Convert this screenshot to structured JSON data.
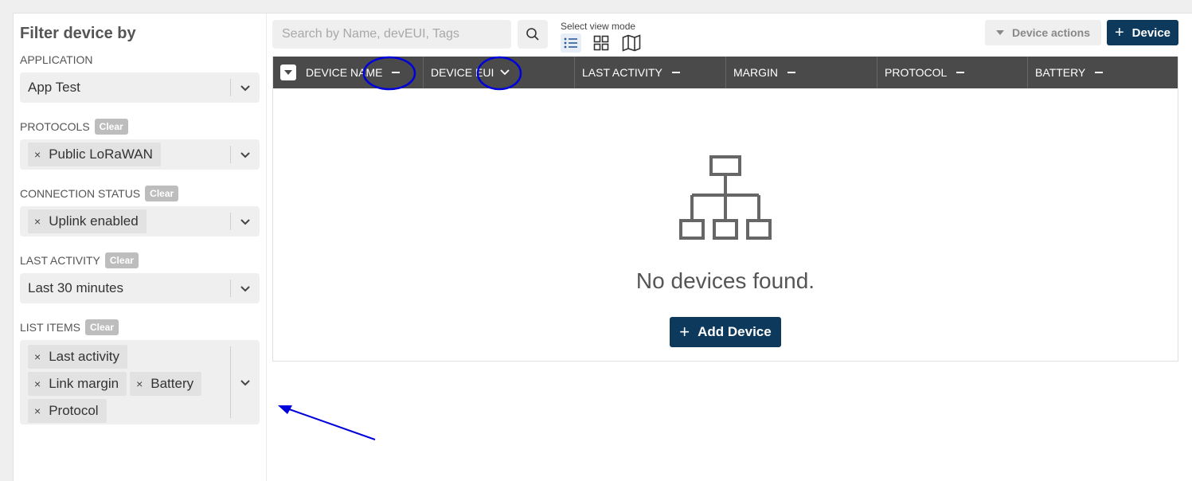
{
  "sidebar": {
    "title": "Filter device by",
    "application": {
      "label": "APPLICATION",
      "value": "App Test"
    },
    "protocols": {
      "label": "PROTOCOLS",
      "clear": "Clear",
      "tags": [
        "Public LoRaWAN"
      ]
    },
    "connection_status": {
      "label": "CONNECTION STATUS",
      "clear": "Clear",
      "tags": [
        "Uplink enabled"
      ]
    },
    "last_activity": {
      "label": "LAST ACTIVITY",
      "clear": "Clear",
      "value": "Last 30 minutes"
    },
    "list_items": {
      "label": "LIST ITEMS",
      "clear": "Clear",
      "tags": [
        "Last activity",
        "Link margin",
        "Battery",
        "Protocol"
      ]
    },
    "tag_remove": "×"
  },
  "toolbar": {
    "search_placeholder": "Search by Name, devEUI, Tags",
    "view_mode_label": "Select view mode",
    "device_actions_label": "Device actions",
    "device_button_label": "Device",
    "plus": "+"
  },
  "table": {
    "columns": [
      "DEVICE NAME",
      "DEVICE EUI",
      "LAST ACTIVITY",
      "MARGIN",
      "PROTOCOL",
      "BATTERY"
    ],
    "empty_message": "No devices found.",
    "add_button_label": "Add Device"
  },
  "colors": {
    "primary": "#0d3a5c",
    "header": "#4a4a4a",
    "annotation": "#0000dd"
  }
}
